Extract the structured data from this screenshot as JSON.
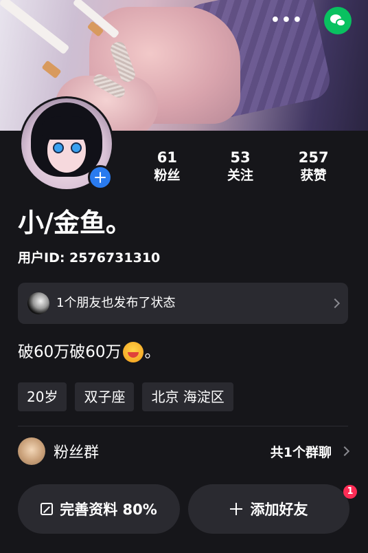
{
  "header": {
    "more_label": "•••"
  },
  "profile": {
    "nickname": "小/金鱼。",
    "user_id": "用户ID: 2576731310",
    "stats": [
      {
        "num": "61",
        "label": "粉丝"
      },
      {
        "num": "53",
        "label": "关注"
      },
      {
        "num": "257",
        "label": "获赞"
      }
    ]
  },
  "friend_card": {
    "text": "1个朋友也发布了状态"
  },
  "bio": {
    "text": "破60万破60万",
    "suffix": "。"
  },
  "tags": [
    "20岁",
    "双子座",
    "北京 海淀区"
  ],
  "fans_group": {
    "label": "粉丝群",
    "count": "共1个群聊"
  },
  "actions": {
    "edit_label": "完善资料 80%",
    "add_friend_label": "添加好友",
    "badge": "1"
  },
  "colors": {
    "background": "#16161a",
    "card": "#2a2a30",
    "accent_blue": "#2a7bef",
    "wechat_green": "#09c160",
    "badge_red": "#fe2c55"
  }
}
